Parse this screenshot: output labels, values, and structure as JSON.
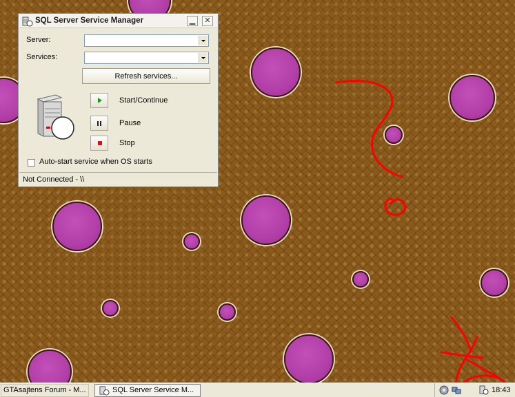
{
  "window": {
    "title": "SQL Server Service Manager",
    "minimize_glyph": "▁",
    "close_glyph": "✕",
    "server_label": "Server:",
    "server_value": "",
    "services_label": "Services:",
    "services_value": "",
    "refresh_label": "Refresh services...",
    "start_label": "Start/Continue",
    "pause_label": "Pause",
    "stop_label": "Stop",
    "autostart_label": "Auto-start service when OS starts",
    "autostart_checked": false,
    "status_text": "Not Connected - \\\\"
  },
  "taskbar": {
    "items": [
      {
        "label": "GTAsajtens Forum - M..."
      },
      {
        "label": "SQL Server Service M..."
      }
    ],
    "clock": "18:43"
  },
  "icons": {
    "title": "sql-server-manager-icon",
    "server": "server-icon",
    "play": "play-icon",
    "pause": "pause-icon",
    "stop": "stop-icon",
    "tray": [
      "speaker-icon",
      "network-icon",
      "sql-tray-icon"
    ]
  },
  "colors": {
    "desktop": "#8a5a1c",
    "bubble": "#b23ea8",
    "scribble": "#ff0000",
    "play": "#1c9b1c",
    "stop": "#e01010"
  }
}
